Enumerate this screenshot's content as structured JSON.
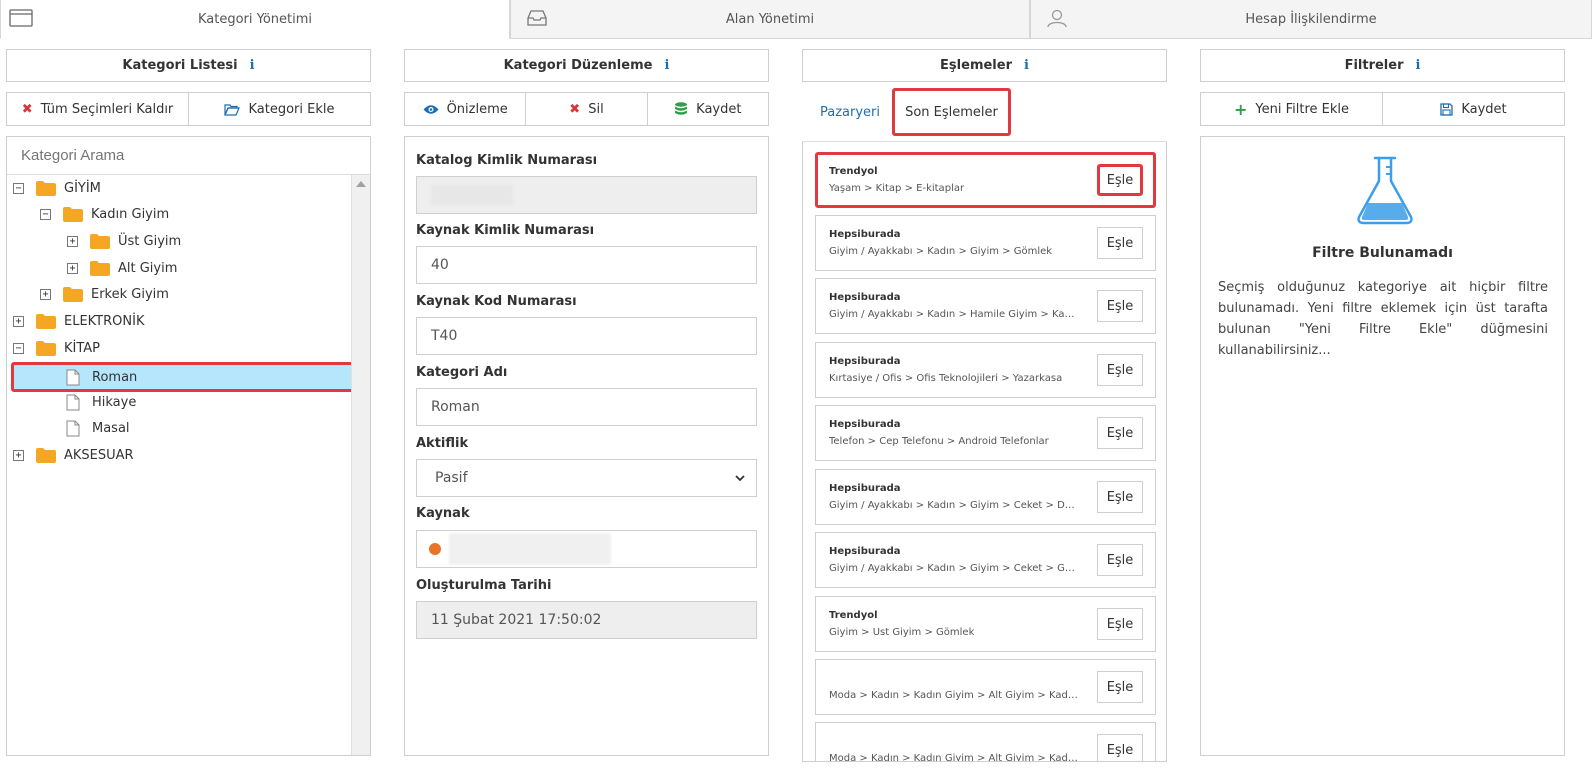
{
  "tabs": [
    {
      "label": "Kategori Yönetimi",
      "icon": "window-icon",
      "active": true
    },
    {
      "label": "Alan Yönetimi",
      "icon": "inbox-icon",
      "active": false
    },
    {
      "label": "Hesap İlişkilendirme",
      "icon": "user-icon",
      "active": false
    }
  ],
  "category_list": {
    "title": "Kategori Listesi",
    "info_icon": "i",
    "clear_label": "Tüm Seçimleri Kaldır",
    "add_label": "Kategori Ekle",
    "search_placeholder": "Kategori Arama",
    "tree": [
      {
        "label": "GİYİM",
        "type": "folder",
        "toggle": "⊟"
      },
      {
        "label": "Kadın Giyim",
        "type": "folder",
        "toggle": "⊟"
      },
      {
        "label": "Üst Giyim",
        "type": "folder",
        "toggle": "⊞"
      },
      {
        "label": "Alt Giyim",
        "type": "folder",
        "toggle": "⊞"
      },
      {
        "label": "Erkek Giyim",
        "type": "folder",
        "toggle": "⊞"
      },
      {
        "label": "ELEKTRONİK",
        "type": "folder",
        "toggle": "⊞"
      },
      {
        "label": "KİTAP",
        "type": "folder",
        "toggle": "⊟"
      },
      {
        "label": "Roman",
        "type": "file",
        "selected": true
      },
      {
        "label": "Hikaye",
        "type": "file"
      },
      {
        "label": "Masal",
        "type": "file"
      },
      {
        "label": "AKSESUAR",
        "type": "folder",
        "toggle": "⊞"
      }
    ]
  },
  "category_edit": {
    "title": "Kategori Düzenleme",
    "preview_label": "Önizleme",
    "delete_label": "Sil",
    "save_label": "Kaydet",
    "fields": {
      "catalog_id_label": "Katalog Kimlik Numarası",
      "source_id_label": "Kaynak Kimlik Numarası",
      "source_id_value": "40",
      "source_code_label": "Kaynak Kod Numarası",
      "source_code_value": "T40",
      "name_label": "Kategori Adı",
      "name_value": "Roman",
      "active_label": "Aktiflik",
      "active_value": "Pasif",
      "source_label": "Kaynak",
      "created_label": "Oluşturulma Tarihi",
      "created_value": "11 Şubat 2021 17:50:02"
    }
  },
  "matches": {
    "title": "Eşlemeler",
    "tab_marketplace": "Pazaryeri",
    "tab_recent": "Son Eşlemeler",
    "match_button": "Eşle",
    "items": [
      {
        "source": "Trendyol",
        "path": "Yaşam > Kitap > E-kitaplar",
        "highlighted": true
      },
      {
        "source": "Hepsiburada",
        "path": "Giyim / Ayakkabı > Kadın > Giyim > Gömlek"
      },
      {
        "source": "Hepsiburada",
        "path": "Giyim / Ayakkabı > Kadın > Hamile Giyim > Kazak"
      },
      {
        "source": "Hepsiburada",
        "path": "Kırtasiye / Ofis > Ofis Teknolojileri > Yazarkasa"
      },
      {
        "source": "Hepsiburada",
        "path": "Telefon > Cep Telefonu > Android Telefonlar"
      },
      {
        "source": "Hepsiburada",
        "path": "Giyim / Ayakkabı > Kadın > Giyim > Ceket > Deri Ceket"
      },
      {
        "source": "Hepsiburada",
        "path": "Giyim / Ayakkabı > Kadın > Giyim > Ceket > Günlük C..."
      },
      {
        "source": "Trendyol",
        "path": "Giyim > Üst Giyim > Gömlek"
      },
      {
        "source": "",
        "path": "Moda > Kadın > Kadın Giyim > Alt Giyim > Kadın Etek"
      },
      {
        "source": "",
        "path": "Moda > Kadın > Kadın Giyim > Alt Giyim > Kadın Pan..."
      }
    ]
  },
  "filters": {
    "title": "Filtreler",
    "add_label": "Yeni Filtre Ekle",
    "save_label": "Kaydet",
    "empty_title": "Filtre Bulunamadı",
    "empty_text": "Seçmiş olduğunuz kategoriye ait hiçbir filtre bulunamadı. Yeni filtre eklemek için üst tarafta bulunan \"Yeni Filtre Ekle\" düğmesini kullanabilirsiniz..."
  },
  "colors": {
    "accent_blue": "#1a6fb0",
    "highlight_red": "#e03a3e",
    "selected_bg": "#b6e6fb",
    "folder_orange": "#f5a623",
    "status_orange": "#e8742a"
  }
}
